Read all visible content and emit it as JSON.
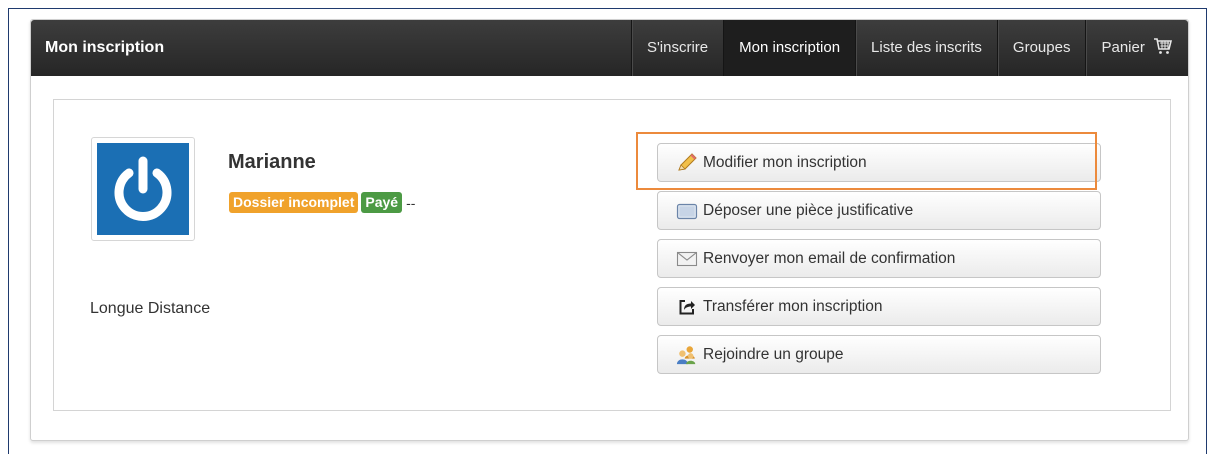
{
  "header": {
    "title": "Mon inscription",
    "nav": [
      {
        "label": "S'inscrire",
        "active": false
      },
      {
        "label": "Mon inscription",
        "active": true
      },
      {
        "label": "Liste des inscrits",
        "active": false
      },
      {
        "label": "Groupes",
        "active": false
      },
      {
        "label": "Panier",
        "active": false,
        "icon": "cart-icon"
      }
    ]
  },
  "profile": {
    "name": "Marianne",
    "badges": {
      "status": "Dossier incomplet",
      "payment": "Payé",
      "extra": "--"
    },
    "category": "Longue Distance",
    "avatar_icon": "power-icon"
  },
  "actions": [
    {
      "label": "Modifier mon inscription",
      "icon": "pencil-icon",
      "highlighted": true
    },
    {
      "label": "Déposer une pièce justificative",
      "icon": "document-icon"
    },
    {
      "label": "Renvoyer mon email de confirmation",
      "icon": "envelope-icon"
    },
    {
      "label": "Transférer mon inscription",
      "icon": "share-icon"
    },
    {
      "label": "Rejoindre un groupe",
      "icon": "group-icon"
    }
  ],
  "colors": {
    "navbar": "#2b2b2b",
    "badge_warning": "#f0a22b",
    "badge_success": "#4c9a44",
    "highlight": "#ec8a3c",
    "avatar_bg": "#1b6fb4"
  }
}
